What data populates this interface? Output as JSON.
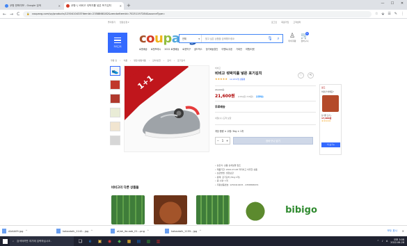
{
  "browser": {
    "tabs": [
      {
        "label": "쿠팡 한쩌여보 - Google 검색",
        "favicon_color": "#4285f4",
        "active": false
      },
      {
        "label": "쿠팡! | 비비고 섞박지를 넣은 포기김치",
        "favicon_color": "#d43b26",
        "active": true
      }
    ],
    "new_tab": "+",
    "window_controls": [
      "—",
      "☐",
      "✕"
    ],
    "nav": {
      "back": "←",
      "forward": "→",
      "reload": "C",
      "home": "⌂"
    },
    "url": "coupang.com/vp/products/1250410433?itemId=2358868182&vendorItemId=70251197284&sourceType=",
    "right_icons": [
      "☆",
      "⬙",
      "☰",
      "✎",
      "⋮"
    ]
  },
  "site": {
    "top_links_left": [
      "즐겨찾기",
      "입점신청 ▾"
    ],
    "top_links_right": [
      "로그인",
      "회원가입",
      "고객센터"
    ],
    "category_label": "카테고리",
    "logo_letters": [
      "c",
      "o",
      "u",
      "p",
      "a",
      "n",
      "g"
    ],
    "search": {
      "category": "전체",
      "placeholder": "찾고 싶은 상품을 검색해보세요!",
      "mic": "🎙",
      "icon": "⌕"
    },
    "my_label": "마이쿠팡",
    "cart_label": "장바구니",
    "cart_count": "0",
    "quicknav": [
      "로켓배송",
      "로켓프레시",
      "2022 로켓배송",
      "로켓직구",
      "골드박스",
      "정기배송할인",
      "이벤트/쿠폰",
      "기획전",
      "여행/티켓"
    ],
    "breadcrumbs": [
      "쿠팡 홈",
      "식품",
      "냉장/냉동식품",
      "김치/반찬",
      "김치",
      "포기김치"
    ]
  },
  "product": {
    "brand": "비비고",
    "name": "비비고 섞박지를 넣은 포기김치",
    "stars": "★★★★★",
    "review_count": "12,972개 상품평",
    "original_price": "25,400원",
    "price": "21,600원",
    "unit_price": "(100g당 216원)",
    "rocket": "로켓배송",
    "shipping": "무료배송",
    "arrival": "내일(수) 도착 보장",
    "option": "개당 중량 × 수량: 5kg × 1개",
    "qty": {
      "minus": "−",
      "value": "1",
      "plus": "+"
    },
    "cart_button": "장바구니 담기",
    "ribbon": "1+1",
    "bullets": [
      "상온식: 상품 상세설명 참조",
      "제품기한: 2022-07-08 까지이고 이후한 상품",
      "보관방법: 냉장보관",
      "원재: 포기김치 (5kg 1개)",
      "총 수량: 1개",
      "쿠팡상품번호: 1250410433 - 2358868074"
    ],
    "wish_icon": "♡",
    "share_icon": "<"
  },
  "sidebar_ad": {
    "header": "광고",
    "sub": "이런건 어때요?",
    "name": "동가원 포기...",
    "price": "17,900원",
    "stars": "★★★★★",
    "button": "더 보기 ▸"
  },
  "more": {
    "title": "비비고의 다른 상품들",
    "brand_logo": "bibigo"
  },
  "downloads": {
    "items": [
      {
        "name": "AAAA09.jpg"
      },
      {
        "name": "kakaotalk_1142...jpg"
      },
      {
        "name": "at/ok_ita.aab_01...png"
      },
      {
        "name": "kakaotalk_1155...jpg"
      }
    ],
    "chevron": "^",
    "show_all": "모두 표시",
    "close": "✕"
  },
  "taskbar": {
    "search_placeholder": "검색하려면 여기에 입력하십시오.",
    "apps": [
      {
        "icon": "❏",
        "color": "#fff"
      },
      {
        "icon": "e",
        "color": "#1e88e5"
      },
      {
        "icon": "▣",
        "color": "#f3c24a"
      },
      {
        "icon": "◉",
        "color": "#e53935"
      },
      {
        "icon": "◆",
        "color": "#4caf50"
      },
      {
        "icon": "▦",
        "color": "#fbc02d"
      },
      {
        "icon": "▤",
        "color": "#1565c0"
      },
      {
        "icon": "▩",
        "color": "#2e7d32"
      },
      {
        "icon": "▥",
        "color": "#c62828"
      }
    ],
    "time": "오후 3:08",
    "date": "2022-06-28",
    "tray": [
      "^",
      "♪",
      "A"
    ]
  }
}
